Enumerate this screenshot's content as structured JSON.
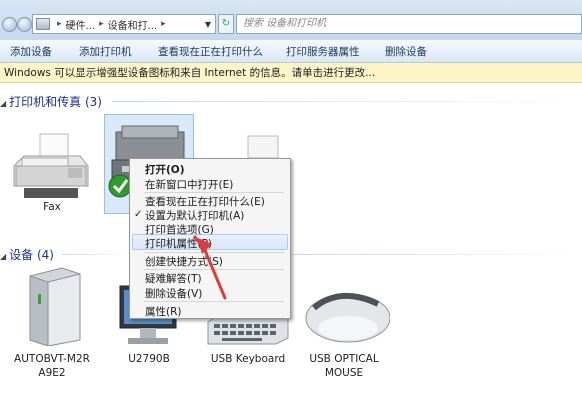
{
  "address_bar": {
    "path_segments": [
      "硬件...",
      "设备和打..."
    ],
    "search_placeholder": "搜索 设备和打印机"
  },
  "command_bar": {
    "items": [
      "添加设备",
      "添加打印机",
      "查看现在正在打印什么",
      "打印服务器属性",
      "删除设备"
    ]
  },
  "info_bar": {
    "text": "Windows 可以显示增强型设备图标和来自 Internet 的信息。请单击进行更改..."
  },
  "groups": {
    "printers": {
      "header": "打印机和传真 (3)",
      "items": [
        "Fax"
      ]
    },
    "devices": {
      "header": "设备 (4)",
      "items": [
        {
          "line1": "AUTOBVT-M2R",
          "line2": "A9E2"
        },
        {
          "line1": "U2790B",
          "line2": ""
        },
        {
          "line1": "USB Keyboard",
          "line2": ""
        },
        {
          "line1": "USB OPTICAL",
          "line2": "MOUSE"
        }
      ]
    }
  },
  "context_menu": {
    "items": [
      {
        "label": "打开(O)",
        "bold": true
      },
      {
        "label": "在新窗口中打开(E)"
      },
      {
        "label": "查看现在正在打印什么(E)"
      },
      {
        "label": "设置为默认打印机(A)",
        "checked": true
      },
      {
        "label": "打印首选项(G)"
      },
      {
        "label": "打印机属性(P)",
        "highlighted": true
      },
      {
        "label": "创建快捷方式(S)"
      },
      {
        "label": "疑难解答(T)"
      },
      {
        "label": "删除设备(V)"
      },
      {
        "label": "属性(R)"
      }
    ]
  },
  "colors": {
    "annotation_arrow": "#e03a3a",
    "menu_highlight": "#d7e6f8",
    "group_header": "#1e3287"
  }
}
